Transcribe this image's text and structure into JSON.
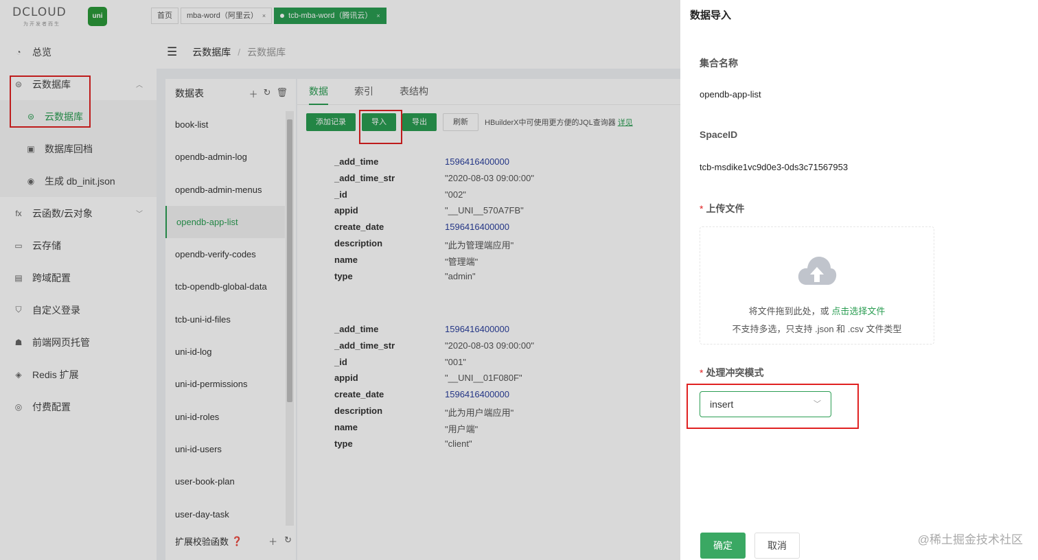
{
  "logo": {
    "text": "DCLOUD",
    "slogan": "为开发者而生",
    "badge": "uni"
  },
  "tabs": [
    {
      "label": "首页"
    },
    {
      "label": "mba-word（阿里云）",
      "close": "×"
    },
    {
      "label": "tcb-mba-word（腾讯云）",
      "close": "×"
    }
  ],
  "sidebar": {
    "items": [
      {
        "label": "总览",
        "icon": "dashboard-icon"
      },
      {
        "label": "云数据库",
        "icon": "database-icon"
      },
      {
        "label": "云数据库",
        "icon": "database-icon"
      },
      {
        "label": "数据库回档",
        "icon": "restore-icon"
      },
      {
        "label": "生成 db_init.json",
        "icon": "generate-icon"
      },
      {
        "label": "云函数/云对象",
        "icon": "function-icon",
        "glyph": "fx"
      },
      {
        "label": "云存储",
        "icon": "storage-icon"
      },
      {
        "label": "跨域配置",
        "icon": "cors-icon"
      },
      {
        "label": "自定义登录",
        "icon": "shield-icon"
      },
      {
        "label": "前端网页托管",
        "icon": "hosting-icon"
      },
      {
        "label": "Redis 扩展",
        "icon": "redis-icon"
      },
      {
        "label": "付费配置",
        "icon": "billing-icon"
      }
    ]
  },
  "breadcrumb": {
    "root": "云数据库",
    "sep": "/",
    "current": "云数据库"
  },
  "tables_panel": {
    "title": "数据表",
    "items": [
      "book-list",
      "opendb-admin-log",
      "opendb-admin-menus",
      "opendb-app-list",
      "opendb-verify-codes",
      "tcb-opendb-global-data",
      "tcb-uni-id-files",
      "uni-id-log",
      "uni-id-permissions",
      "uni-id-roles",
      "uni-id-users",
      "user-book-plan",
      "user-day-task"
    ],
    "footer": "扩展校验函数"
  },
  "main": {
    "tabs": [
      "数据",
      "索引",
      "表结构"
    ],
    "toolbar": {
      "add": "添加记录",
      "import": "导入",
      "export": "导出",
      "refresh": "刷新",
      "hint": "HBuilderX中可使用更方便的JQL查询器",
      "hint_link": "详见"
    },
    "records": [
      {
        "fields": [
          {
            "k": "_add_time",
            "v": "1596416400000",
            "num": true
          },
          {
            "k": "_add_time_str",
            "v": "\"2020-08-03 09:00:00\""
          },
          {
            "k": "_id",
            "v": "\"002\""
          },
          {
            "k": "appid",
            "v": "\"__UNI__570A7FB\""
          },
          {
            "k": "create_date",
            "v": "1596416400000",
            "num": true
          },
          {
            "k": "description",
            "v": "\"此为管理端应用\""
          },
          {
            "k": "name",
            "v": "\"管理端\""
          },
          {
            "k": "type",
            "v": "\"admin\""
          }
        ]
      },
      {
        "fields": [
          {
            "k": "_add_time",
            "v": "1596416400000",
            "num": true
          },
          {
            "k": "_add_time_str",
            "v": "\"2020-08-03 09:00:00\""
          },
          {
            "k": "_id",
            "v": "\"001\""
          },
          {
            "k": "appid",
            "v": "\"__UNI__01F080F\""
          },
          {
            "k": "create_date",
            "v": "1596416400000",
            "num": true
          },
          {
            "k": "description",
            "v": "\"此为用户端应用\""
          },
          {
            "k": "name",
            "v": "\"用户端\""
          },
          {
            "k": "type",
            "v": "\"client\""
          }
        ]
      }
    ]
  },
  "drawer": {
    "title": "数据导入",
    "collection_label": "集合名称",
    "collection_value": "opendb-app-list",
    "spaceid_label": "SpaceID",
    "spaceid_value": "tcb-msdike1vc9d0e3-0ds3c71567953",
    "upload_label": "上传文件",
    "upload_text": "将文件拖到此处，或",
    "upload_link": "点击选择文件",
    "upload_hint": "不支持多选，只支持 .json 和 .csv 文件类型",
    "conflict_label": "处理冲突模式",
    "conflict_value": "insert",
    "confirm": "确定",
    "cancel": "取消"
  },
  "watermark": "@稀土掘金技术社区",
  "colors": {
    "accent": "#2a9d52",
    "highlight_box": "#e02020",
    "number": "#2a3f9d"
  }
}
